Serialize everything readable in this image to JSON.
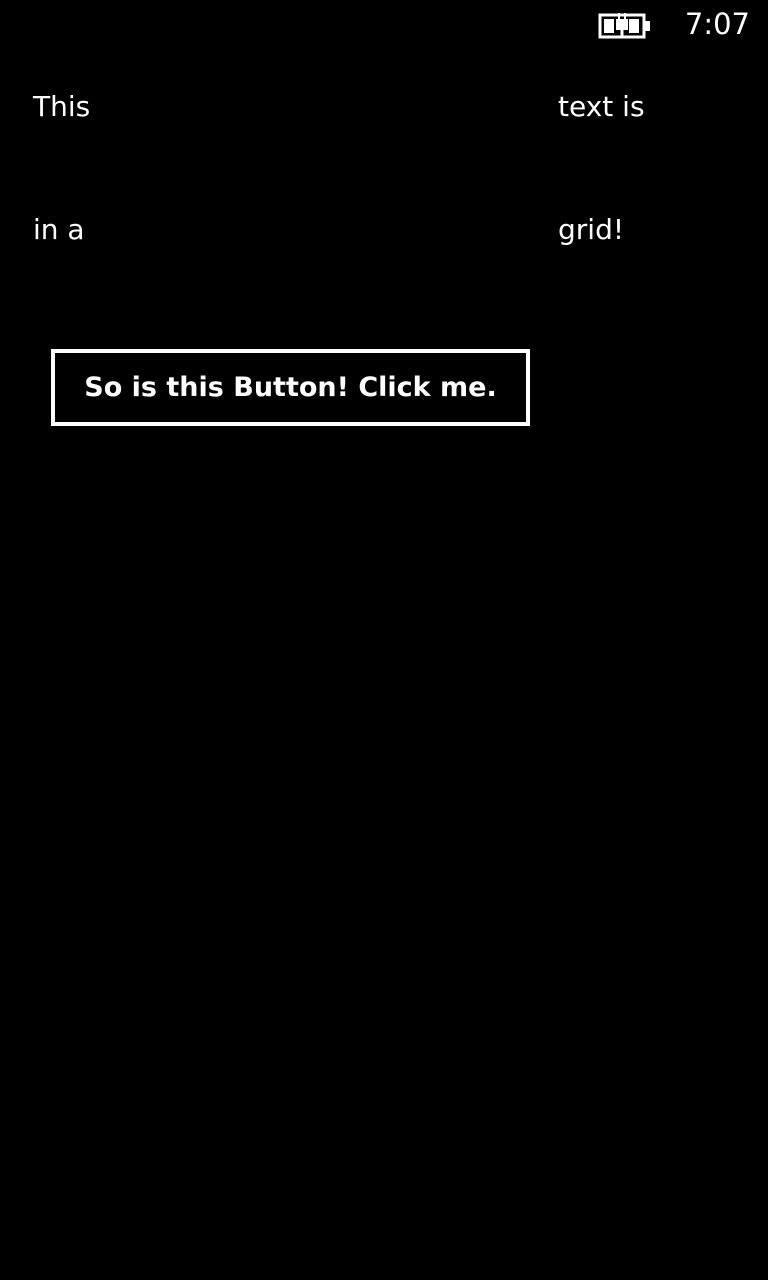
{
  "status_bar": {
    "time": "7:07",
    "battery_icon": "battery-charging-icon"
  },
  "grid": {
    "row1": {
      "left": "This",
      "right": "text is"
    },
    "row2": {
      "left": "in a",
      "right": "grid!"
    }
  },
  "button": {
    "label": "So is this Button! Click me."
  },
  "colors": {
    "background": "#000000",
    "foreground": "#ffffff"
  }
}
